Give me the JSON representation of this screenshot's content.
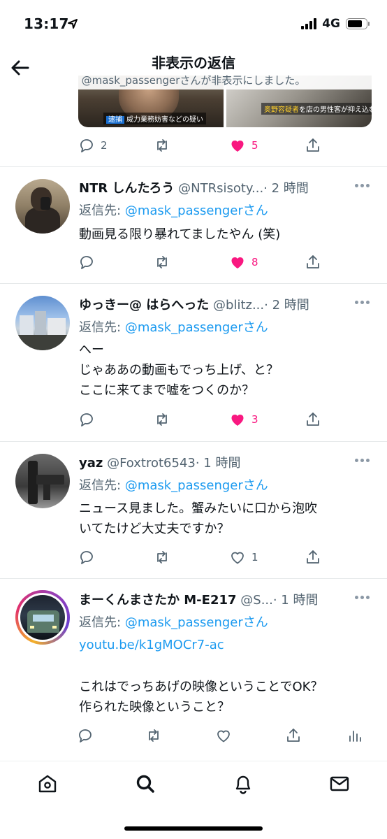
{
  "status_bar": {
    "time": "13:17",
    "network": "4G"
  },
  "header": {
    "title": "非表示の返信",
    "subtitle": "@mask_passengerさんが非表示にしました。",
    "back_icon": "back-arrow-icon"
  },
  "top_tweet": {
    "image1_caption_tag": "逮捕",
    "image1_caption": "威力業務妨害などの疑い",
    "image2_caption_name": "奥野容疑者",
    "image2_caption": "を店の男性客が抑え込む",
    "reply_count": "2",
    "like_count": "5"
  },
  "tweets": [
    {
      "name": "NTR しんたろう",
      "handle": "@NTRsisoty...",
      "time": "· 2 時間",
      "reply_label": "返信先:",
      "reply_to": "@mask_passenger",
      "reply_suffix": "さん",
      "body": "動画見る限り暴れてましたやん (笑)",
      "like_count": "8",
      "liked": true
    },
    {
      "name": "ゆっきー@ はらへった",
      "handle": "@blitz...",
      "time": "· 2 時間",
      "reply_label": "返信先:",
      "reply_to": "@mask_passenger",
      "reply_suffix": "さん",
      "body": "へー\nじゃああの動画もでっち上げ、と？\nここに来てまで嘘をつくのか？",
      "like_count": "3",
      "liked": true
    },
    {
      "name": "yaz",
      "handle": "@Foxtrot6543",
      "time": "· 1 時間",
      "reply_label": "返信先:",
      "reply_to": "@mask_passenger",
      "reply_suffix": "さん",
      "body": "ニュース見ました。蟹みたいに口から泡吹\nいてたけど大丈夫ですか？",
      "like_count": "1",
      "liked": false
    },
    {
      "name": "まーくんまさたか M-E217",
      "handle": "@S...",
      "time": "· 1 時間",
      "reply_label": "返信先:",
      "reply_to": "@mask_passenger",
      "reply_suffix": "さん",
      "link": "youtu.be/k1gMOCr7-ac",
      "body": "これはでっちあげの映像ということでOK？\n作られた映像ということ？"
    }
  ],
  "colors": {
    "link": "#1d9bf0",
    "like": "#f91880",
    "muted": "#536471"
  },
  "tab_bar": [
    "home-icon",
    "search-icon",
    "notifications-icon",
    "messages-icon"
  ]
}
